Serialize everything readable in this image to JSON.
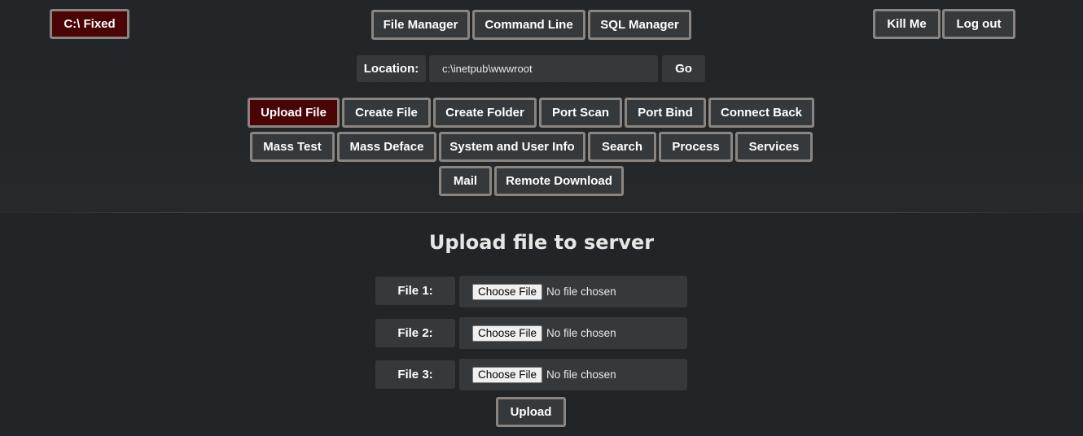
{
  "header": {
    "drive_label": "C:\\ Fixed",
    "nav": [
      "File Manager",
      "Command Line",
      "SQL Manager"
    ],
    "kill_label": "Kill Me",
    "logout_label": "Log out"
  },
  "location": {
    "label": "Location:",
    "value": "c:\\inetpub\\wwwroot",
    "go_label": "Go"
  },
  "tools": {
    "row1": [
      "Upload File",
      "Create File",
      "Create Folder",
      "Port Scan",
      "Port Bind",
      "Connect Back"
    ],
    "row2": [
      "Mass Test",
      "Mass Deface",
      "System and User Info",
      "Search",
      "Process",
      "Services"
    ],
    "row3": [
      "Mail",
      "Remote Download"
    ],
    "active": "Upload File"
  },
  "upload": {
    "title": "Upload file to server",
    "files": [
      {
        "label": "File 1:",
        "choose": "Choose File",
        "status": "No file chosen"
      },
      {
        "label": "File 2:",
        "choose": "Choose File",
        "status": "No file chosen"
      },
      {
        "label": "File 3:",
        "choose": "Choose File",
        "status": "No file chosen"
      }
    ],
    "submit_label": "Upload"
  },
  "colors": {
    "background": "#222527",
    "button": "#35393b",
    "button_border": "#8a8580",
    "active_button": "#4a0404"
  }
}
